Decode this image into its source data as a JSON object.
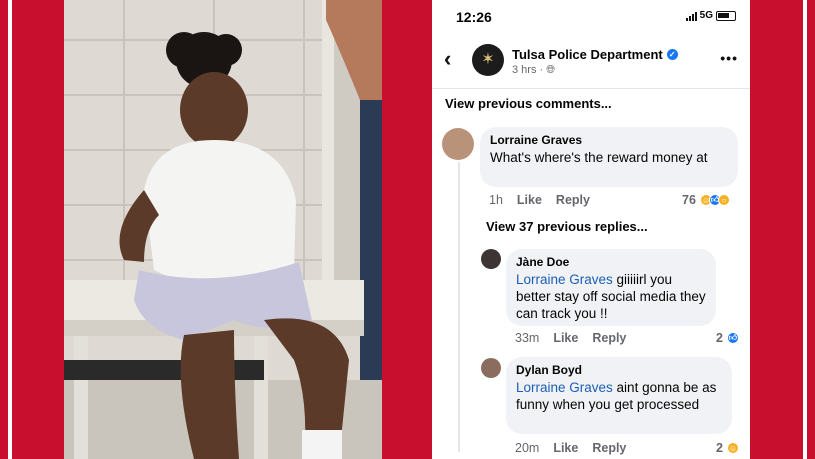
{
  "phone": {
    "status": {
      "time": "12:26",
      "network": "5G"
    },
    "header": {
      "back_icon": "chevron-left-icon",
      "page_name": "Tulsa Police Department",
      "meta": "3 hrs · ",
      "globe_icon": "globe-icon",
      "more": "•••"
    },
    "view_previous_comments": "View previous comments...",
    "comments": [
      {
        "author": "Lorraine Graves",
        "text": "What's where's the reward money at",
        "time": "1h",
        "like": "Like",
        "reply": "Reply",
        "reaction_count": "76",
        "reactions": [
          "haha",
          "like",
          "wow"
        ]
      }
    ],
    "view_replies": "View 37 previous replies...",
    "replies": [
      {
        "author": "Jàne Doe",
        "mention": "Lorraine Graves",
        "text": " giiiiirl you better stay off social media they can track you !!",
        "time": "33m",
        "like": "Like",
        "reply": "Reply",
        "reaction_count": "2",
        "reactions": [
          "like"
        ]
      },
      {
        "author": "Dylan Boyd",
        "mention": "Lorraine Graves",
        "text": " aint gonna be as funny when you get processed",
        "time": "20m",
        "like": "Like",
        "reply": "Reply",
        "reaction_count": "2",
        "reactions": [
          "haha"
        ]
      }
    ]
  },
  "colors": {
    "frame_red": "#c8102e",
    "facebook_blue": "#1877f2",
    "mention_blue": "#1a5fb4",
    "bubble_gray": "#f0f2f5"
  }
}
